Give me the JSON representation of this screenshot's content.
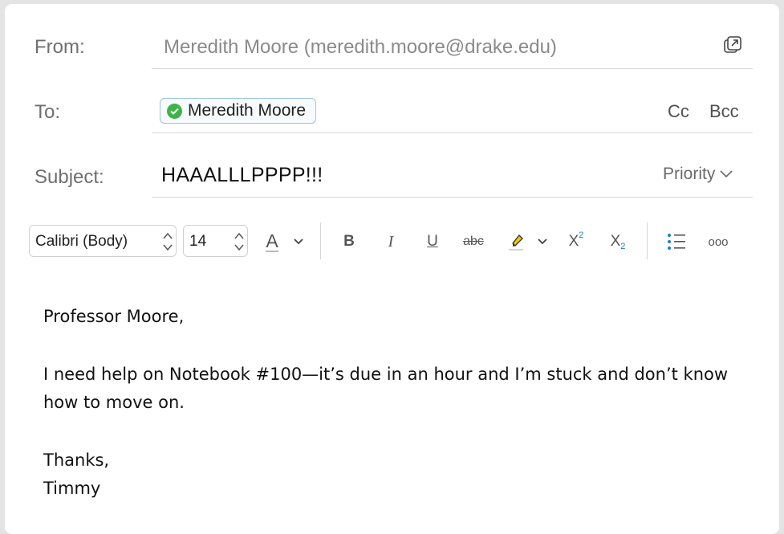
{
  "header": {
    "from_label": "From:",
    "from_value": "Meredith Moore (meredith.moore@drake.edu)",
    "to_label": "To:",
    "to_recipient": "Meredith Moore",
    "cc_label": "Cc",
    "bcc_label": "Bcc",
    "subject_label": "Subject:",
    "subject_value": "HAAALLLPPPP!!!",
    "priority_label": "Priority"
  },
  "toolbar": {
    "font_family": "Calibri (Body)",
    "font_size": "14",
    "font_color_glyph": "A",
    "bold": "B",
    "italic": "I",
    "underline": "U",
    "strikethrough": "abc",
    "superscript_base": "X",
    "superscript_exp": "2",
    "subscript_base": "X",
    "subscript_exp": "2",
    "more": "ooo"
  },
  "body": {
    "greeting": "Professor Moore,",
    "paragraph": "I need help on Notebook #100—it’s due in an hour and I’m stuck and don’t know how to move on.",
    "closing": "Thanks,",
    "signature": "Timmy"
  },
  "colors": {
    "accent": "#1f7ad6",
    "highlighter": "#f5c400",
    "recipient_check": "#3fb349",
    "chip_border": "#9cc3e8"
  }
}
